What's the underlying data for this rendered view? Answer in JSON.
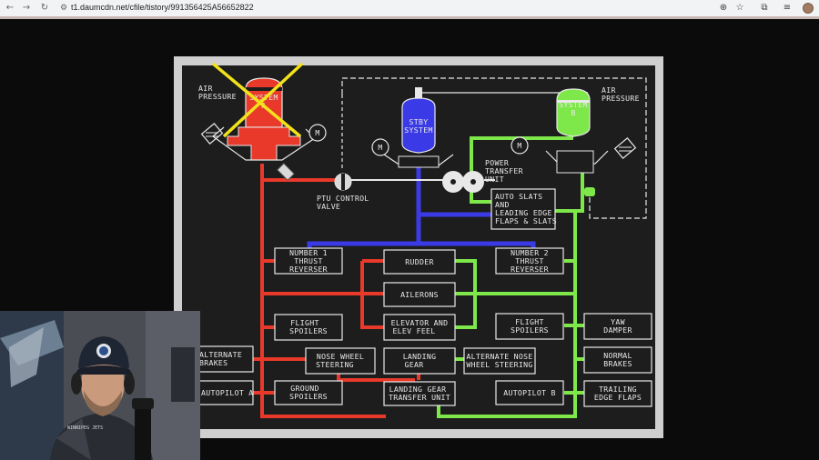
{
  "browser": {
    "url": "t1.daumcdn.net/cfile/tistory/991356425A56652822"
  },
  "diagram": {
    "labels": {
      "air_pressure_a": [
        "AIR",
        "PRESSURE"
      ],
      "air_pressure_b": [
        "AIR",
        "PRESSURE"
      ],
      "system_a": [
        "SYSTEM",
        "A"
      ],
      "stby_system": [
        "STBY",
        "SYSTEM"
      ],
      "system_b": [
        "SYSTEM",
        "B"
      ],
      "ptu_control_valve": [
        "PTU CONTROL",
        "VALVE"
      ],
      "power_transfer_unit": [
        "POWER",
        "TRANSFER",
        "UNIT"
      ],
      "motor": "M"
    },
    "boxes": {
      "auto_slats": [
        "AUTO SLATS",
        "AND",
        "LEADING EDGE",
        "FLAPS & SLATS"
      ],
      "number1_thrust_reverser": [
        "NUMBER 1",
        "THRUST",
        "REVERSER"
      ],
      "rudder": [
        "RUDDER"
      ],
      "number2_thrust_reverser": [
        "NUMBER 2",
        "THRUST",
        "REVERSER"
      ],
      "ailerons": [
        "AILERONS"
      ],
      "flight_spoilers_left": [
        "FLIGHT",
        "SPOILERS"
      ],
      "elevator": [
        "ELEVATOR AND",
        "ELEV FEEL"
      ],
      "flight_spoilers_right": [
        "FLIGHT",
        "SPOILERS"
      ],
      "yaw_damper": [
        "YAW",
        "DAMPER"
      ],
      "alternate_brakes": [
        "ALTERNATE",
        "BRAKES"
      ],
      "nose_wheel_steering": [
        "NOSE WHEEL",
        "STEERING"
      ],
      "landing_gear": [
        "LANDING",
        "GEAR"
      ],
      "alternate_nose_wheel_steering": [
        "ALTERNATE NOSE",
        "WHEEL STEERING"
      ],
      "normal_brakes": [
        "NORMAL",
        "BRAKES"
      ],
      "autopilot_a": [
        "AUTOPILOT A"
      ],
      "ground_spoilers": [
        "GROUND",
        "SPOILERS"
      ],
      "landing_gear_transfer_unit": [
        "LANDING GEAR",
        "TRANSFER UNIT"
      ],
      "autopilot_b": [
        "AUTOPILOT B"
      ],
      "trailing_edge_flaps": [
        "TRAILING",
        "EDGE FLAPS"
      ]
    },
    "colors": {
      "system_a": "#e8392a",
      "standby": "#3a3ae6",
      "system_b": "#7ee84a",
      "failure_cross": "#f2e21a"
    }
  },
  "webcam": {
    "cap_text": "WINNIPEG JETS"
  }
}
